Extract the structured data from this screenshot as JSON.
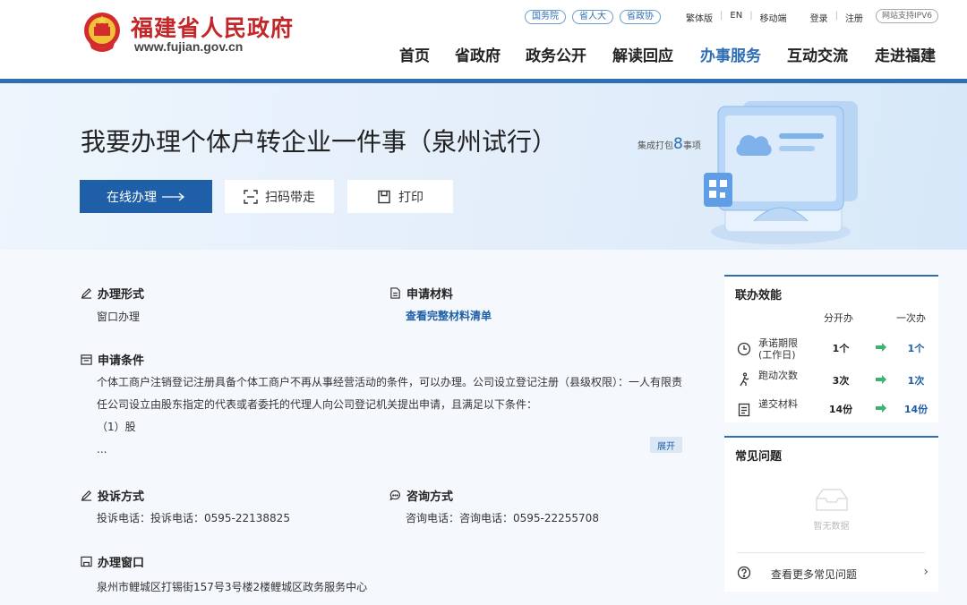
{
  "site": {
    "name": "福建省人民政府",
    "url": "www.fujian.gov.cn",
    "tags": [
      "国务院",
      "省人大",
      "省政协"
    ],
    "links": [
      "繁体版",
      "EN",
      "移动端"
    ],
    "login": "登录",
    "register": "注册",
    "ipv6": "网站支持IPV6"
  },
  "nav": [
    "首页",
    "省政府",
    "政务公开",
    "解读回应",
    "办事服务",
    "互动交流",
    "走进福建"
  ],
  "hero": {
    "title": "我要办理个体户转企业一件事（泉州试行）",
    "count_prefix": "集成打包",
    "count_num": "8",
    "count_suffix": "事项",
    "btn_online": "在线办理",
    "btn_scan": "扫码带走",
    "btn_print": "打印"
  },
  "form": {
    "title": "办理形式",
    "value": "窗口办理"
  },
  "materials": {
    "title": "申请材料",
    "link": "查看完整材料清单"
  },
  "conditions": {
    "title": "申请条件",
    "line1": "个体工商户注销登记注册具备个体工商户不再从事经营活动的条件，可以办理。公司设立登记注册（县级权限）：一人有限责",
    "line2": "任公司设立由股东指定的代表或者委托的代理人向公司登记机关提出申请，且满足以下条件：",
    "line3": "（1）股",
    "line4": "...",
    "expand": "展开"
  },
  "complaint": {
    "title": "投诉方式",
    "value": "投诉电话：投诉电话：0595-22138825"
  },
  "consult": {
    "title": "咨询方式",
    "value": "咨询电话：咨询电话：0595-22255708"
  },
  "window": {
    "title": "办理窗口",
    "value": "泉州市鲤城区打锡街157号3号楼2楼鲤城区政务服务中心"
  },
  "efficiency": {
    "title": "联办效能",
    "col1": "分开办",
    "col2": "一次办",
    "rows": [
      {
        "label": "承诺期限",
        "sub": "(工作日)",
        "v1": "1个",
        "v2": "1个"
      },
      {
        "label": "跑动次数",
        "sub": "",
        "v1": "3次",
        "v2": "1次"
      },
      {
        "label": "递交材料",
        "sub": "",
        "v1": "14份",
        "v2": "14份"
      }
    ]
  },
  "faq": {
    "title": "常见问题",
    "empty": "暂无数据",
    "more": "查看更多常见问题"
  },
  "colors": {
    "brand_red": "#c2282a",
    "brand_blue": "#1f5fa7",
    "arrow_green": "#3cb371"
  }
}
